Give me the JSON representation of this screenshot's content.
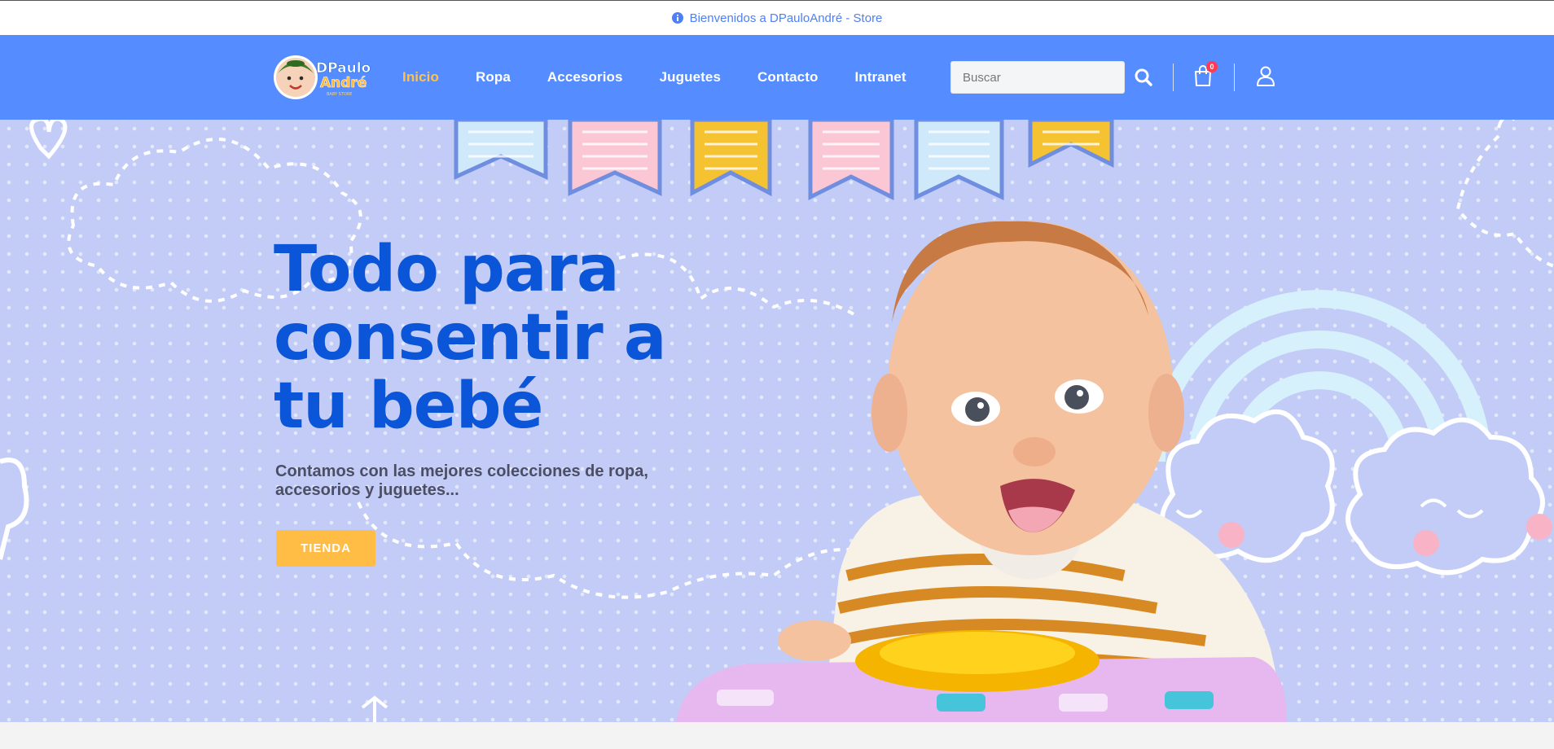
{
  "topbar": {
    "message": "Bienvenidos a DPauloAndré - Store",
    "icon": "info-icon"
  },
  "header": {
    "logo": {
      "line1": "DPaulo",
      "line2": "André",
      "tagline": "BABY STORE"
    },
    "nav": [
      {
        "label": "Inicio",
        "active": true
      },
      {
        "label": "Ropa",
        "active": false
      },
      {
        "label": "Accesorios",
        "active": false
      },
      {
        "label": "Juguetes",
        "active": false
      },
      {
        "label": "Contacto",
        "active": false
      },
      {
        "label": "Intranet",
        "active": false
      }
    ],
    "search": {
      "placeholder": "Buscar",
      "value": ""
    },
    "cart": {
      "count": "0",
      "icon": "shopping-bag-icon"
    },
    "user": {
      "icon": "user-icon"
    }
  },
  "hero": {
    "title_line1": "Todo para",
    "title_line2": "consentir a",
    "title_line3": "tu bebé",
    "subtitle": "Contamos con las mejores colecciones de ropa, accesorios y juguetes...",
    "button_label": "TIENDA"
  },
  "colors": {
    "header_bg": "#558cff",
    "nav_active": "#ffc24a",
    "hero_bg": "#c2ccf7",
    "hero_title": "#0a55d8",
    "button_bg": "#ffbd46",
    "topbar_text": "#4f7ff5",
    "badge": "#ff3b52"
  }
}
